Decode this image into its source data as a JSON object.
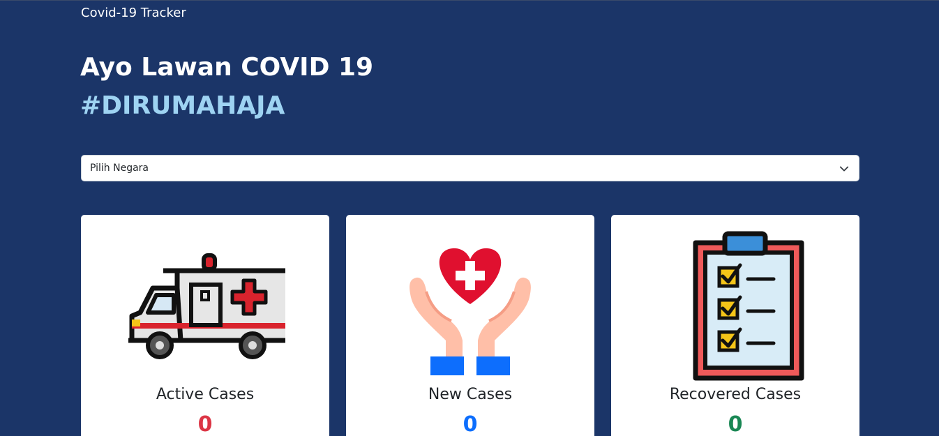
{
  "navbar": {
    "brand": "Covid-19 Tracker"
  },
  "hero": {
    "title": "Ayo Lawan COVID 19",
    "tagline": "#DIRUMAHAJA",
    "tagline_color": "#9ed3f2"
  },
  "country_select": {
    "selected": "Pilih Negara",
    "icon": "chevron-down-icon"
  },
  "cards": [
    {
      "icon": "ambulance-icon",
      "label": "Active Cases",
      "value": "0",
      "color": "#dc3545"
    },
    {
      "icon": "heart-hands-icon",
      "label": "New Cases",
      "value": "0",
      "color": "#0d6efd"
    },
    {
      "icon": "clipboard-checklist-icon",
      "label": "Recovered Cases",
      "value": "0",
      "color": "#198754"
    }
  ],
  "theme": {
    "background": "#1b3568"
  }
}
